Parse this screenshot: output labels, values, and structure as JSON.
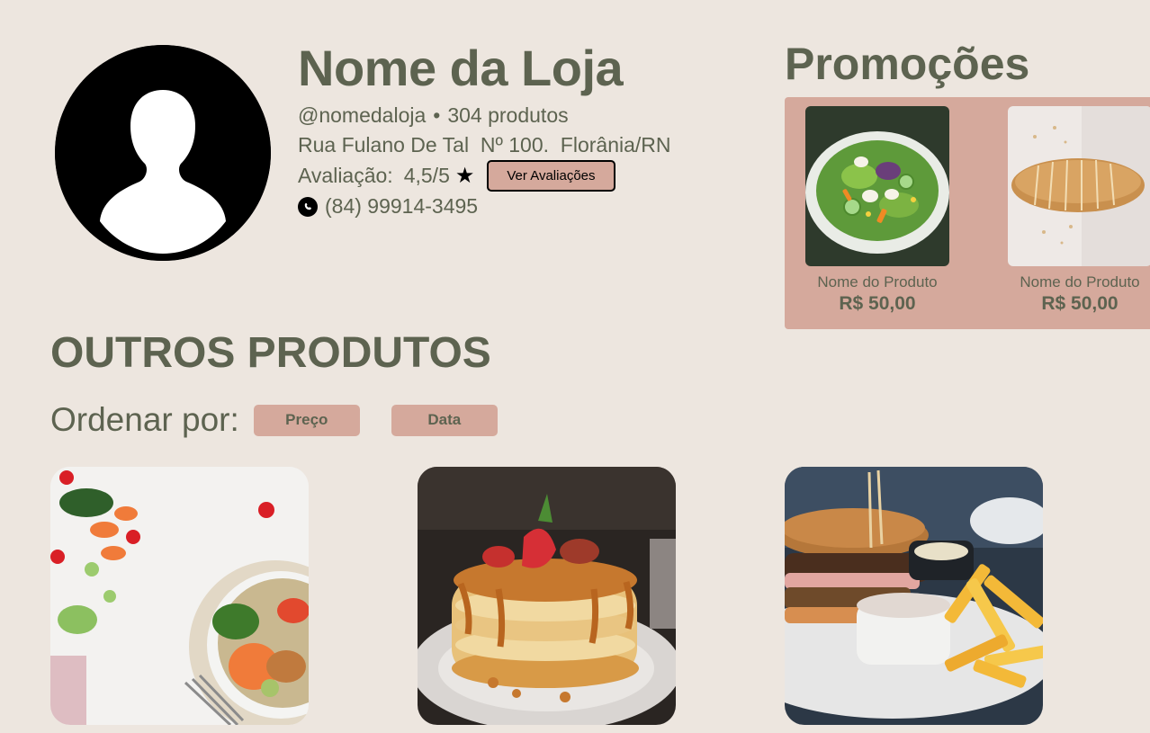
{
  "store": {
    "name": "Nome da Loja",
    "handle": "@nomedaloja",
    "separator": "•",
    "product_count": "304 produtos",
    "address": "Rua Fulano De Tal  Nº 100.  Florânia/RN",
    "rating_label": "Avaliação:",
    "rating_value": "4,5/5",
    "rating_icon": "star-icon",
    "reviews_button": "Ver Avaliações",
    "phone": "(84) 99914-3495",
    "phone_icon": "whatsapp-icon",
    "avatar_icon": "user-silhouette-icon"
  },
  "promotions": {
    "title": "Promoções",
    "items": [
      {
        "name": "Nome do Produto",
        "price": "R$ 50,00",
        "image": "salad"
      },
      {
        "name": "Nome do Produto",
        "price": "R$ 50,00",
        "image": "bread"
      }
    ]
  },
  "other_products": {
    "title": "OUTROS PRODUTOS",
    "sort_label": "Ordenar por:",
    "sort_options": [
      "Preço",
      "Data"
    ],
    "items": [
      {
        "image": "vegetable-bowl"
      },
      {
        "image": "pancakes"
      },
      {
        "image": "burger-fries"
      }
    ]
  },
  "colors": {
    "background": "#EDE6DF",
    "text": "#5D6350",
    "accent": "#D5A99C"
  }
}
